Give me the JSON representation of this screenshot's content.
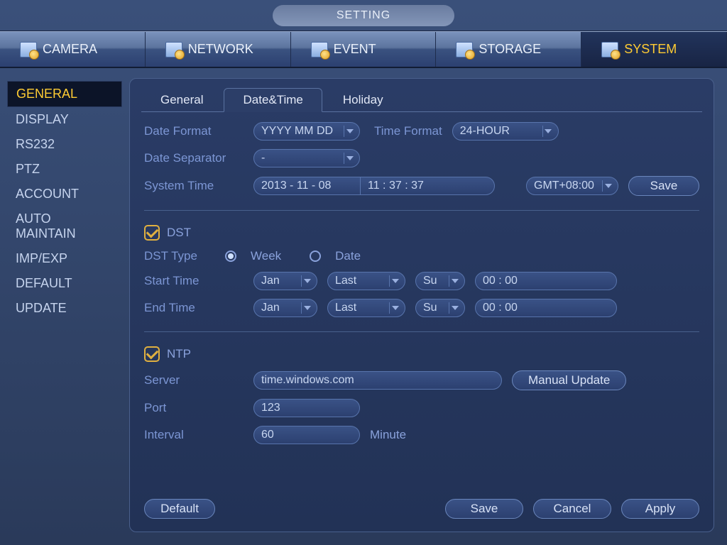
{
  "title": "SETTING",
  "topnav": [
    {
      "label": "CAMERA"
    },
    {
      "label": "NETWORK"
    },
    {
      "label": "EVENT"
    },
    {
      "label": "STORAGE"
    },
    {
      "label": "SYSTEM"
    }
  ],
  "sidebar": [
    "GENERAL",
    "DISPLAY",
    "RS232",
    "PTZ",
    "ACCOUNT",
    "AUTO MAINTAIN",
    "IMP/EXP",
    "DEFAULT",
    "UPDATE"
  ],
  "subtabs": [
    "General",
    "Date&Time",
    "Holiday"
  ],
  "labels": {
    "date_format": "Date Format",
    "time_format": "Time Format",
    "date_separator": "Date Separator",
    "system_time": "System Time",
    "dst": "DST",
    "dst_type": "DST Type",
    "week": "Week",
    "date": "Date",
    "start_time": "Start Time",
    "end_time": "End Time",
    "ntp": "NTP",
    "server": "Server",
    "port": "Port",
    "interval": "Interval",
    "minute": "Minute"
  },
  "values": {
    "date_format": "YYYY MM DD",
    "time_format": "24-HOUR",
    "date_separator": "-",
    "system_date": "2013 - 11 - 08",
    "system_time": "11 : 37 : 37",
    "gmt": "GMT+08:00",
    "start": {
      "month": "Jan",
      "week": "Last",
      "day": "Su",
      "time": "00 :   00"
    },
    "end": {
      "month": "Jan",
      "week": "Last",
      "day": "Su",
      "time": "00 :   00"
    },
    "server": "time.windows.com",
    "port": "123",
    "interval": "60"
  },
  "buttons": {
    "save": "Save",
    "manual_update": "Manual Update",
    "default": "Default",
    "cancel": "Cancel",
    "apply": "Apply"
  }
}
